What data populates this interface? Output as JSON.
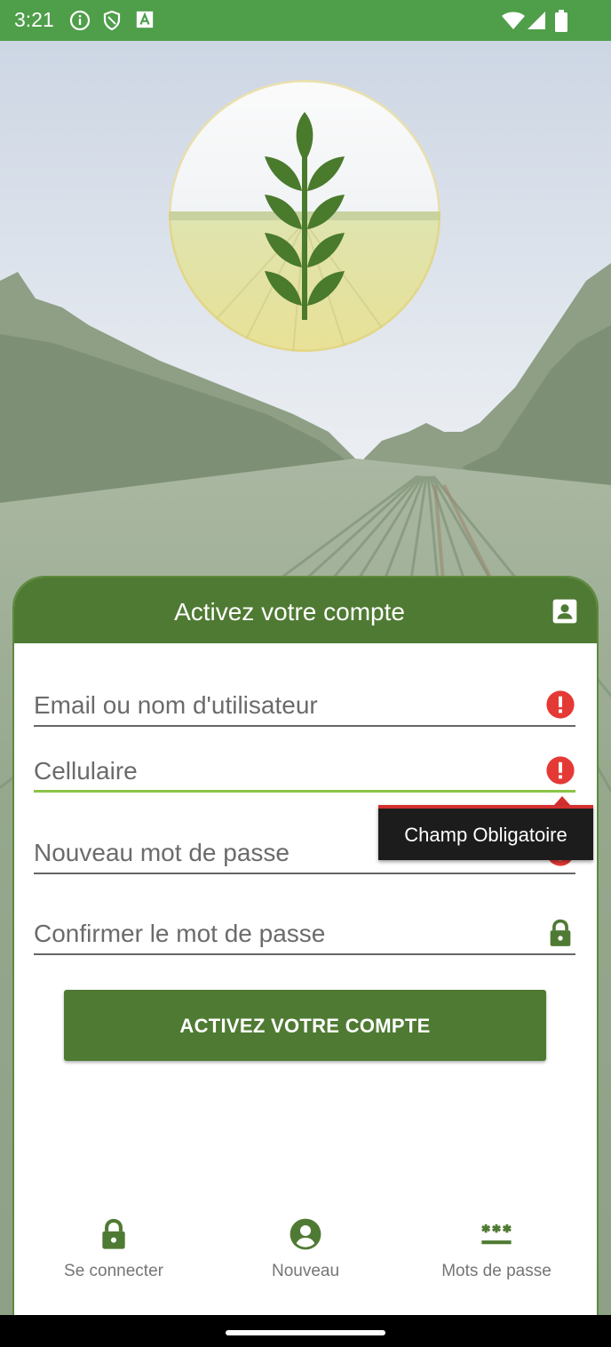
{
  "status_bar": {
    "time": "3:21",
    "left_icons": [
      "info-icon",
      "shield-icon",
      "a-badge-icon"
    ],
    "right_icons": [
      "wifi-icon",
      "cell-signal-icon",
      "battery-icon"
    ],
    "color": "#4f9e4a"
  },
  "logo": {
    "icon": "wheat-icon"
  },
  "card": {
    "title": "Activez votre compte",
    "header_icon": "contact-card-icon",
    "header_color": "#4f7a33"
  },
  "form": {
    "fields": [
      {
        "label": "Email ou nom d'utilisateur",
        "icon": "error-icon"
      },
      {
        "label": "Cellulaire",
        "icon": "error-icon"
      },
      {
        "label": "Nouveau mot de passe",
        "icon": "error-icon"
      },
      {
        "label": "Confirmer le mot de passe",
        "icon": "lock-icon"
      }
    ],
    "tooltip": "Champ Obligatoire",
    "error_color": "#e53935",
    "active_line_color": "#8bc34a"
  },
  "button": {
    "label": "ACTIVEZ VOTRE COMPTE"
  },
  "bottom_nav": [
    {
      "label": "Se connecter",
      "icon": "lock-icon"
    },
    {
      "label": "Nouveau",
      "icon": "account-circle-icon"
    },
    {
      "label": "Mots de passe",
      "icon": "password-icon"
    }
  ]
}
